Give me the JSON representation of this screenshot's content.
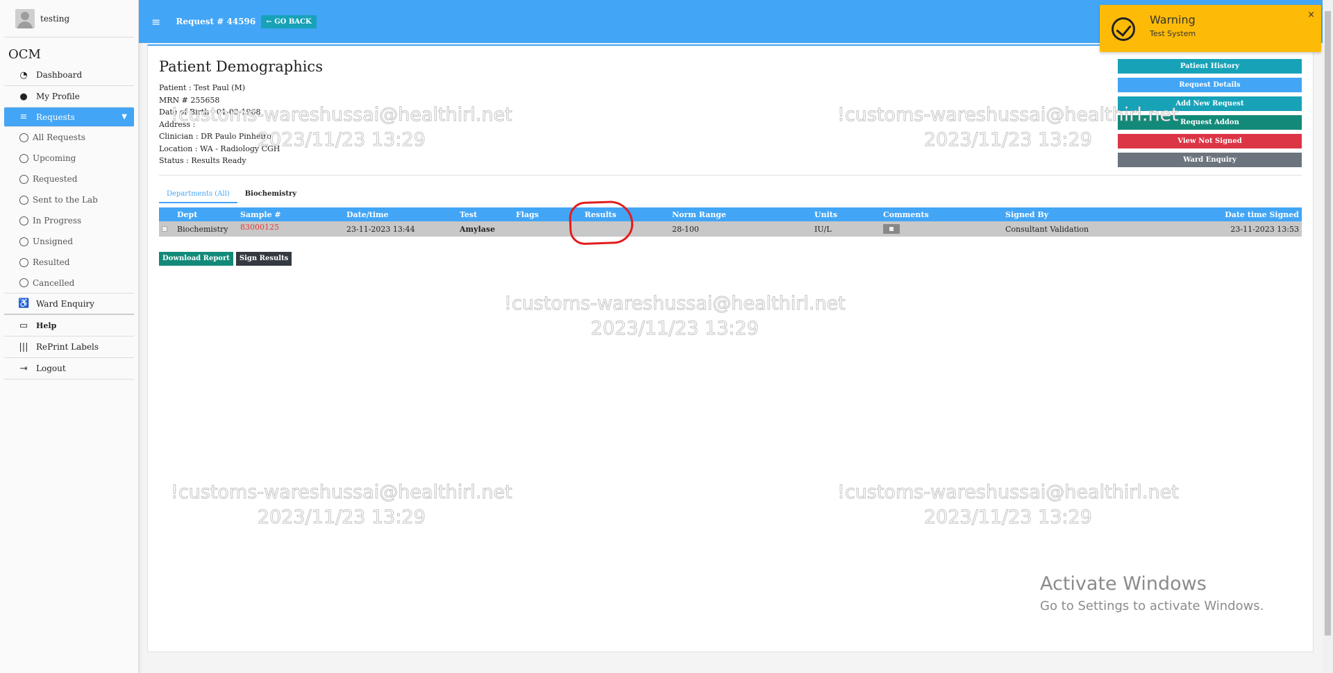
{
  "user": {
    "name": "testing"
  },
  "brand": "OCM",
  "nav": {
    "dashboard": "Dashboard",
    "profile": "My Profile",
    "requests": "Requests",
    "sub": [
      "All Requests",
      "Upcoming",
      "Requested",
      "Sent to the Lab",
      "In Progress",
      "Unsigned",
      "Resulted",
      "Cancelled"
    ],
    "ward": "Ward Enquiry",
    "help": "Help",
    "reprint": "RePrint Labels",
    "logout": "Logout"
  },
  "topbar": {
    "title": "Request # 44596",
    "go_back": "GO BACK"
  },
  "demographics": {
    "title": "Patient Demographics",
    "patient": "Patient : Test Paul (M)",
    "mrn": "MRN # 255658",
    "dob": "Date of Birth : 01-03-1968",
    "address": "Address :",
    "clinician": "Clinician : DR Paulo Pinheiro",
    "location": "Location : WA - Radiology CGH",
    "status": "Status : Results Ready"
  },
  "side_buttons": [
    {
      "label": "Patient History",
      "color": "#17a2b8"
    },
    {
      "label": "Request Details",
      "color": "#42a5f5"
    },
    {
      "label": "Add New Request",
      "color": "#17a2b8"
    },
    {
      "label": "Request Addon",
      "color": "#138a79"
    },
    {
      "label": "View Not Signed",
      "color": "#dc3545"
    },
    {
      "label": "Ward Enquiry",
      "color": "#6c757d"
    }
  ],
  "tabs": {
    "all": "Departments (All)",
    "bio": "Biochemistry"
  },
  "table": {
    "headers": [
      "Dept",
      "Sample #",
      "Date/time",
      "Test",
      "Flags",
      "Results",
      "Norm Range",
      "Units",
      "Comments",
      "Signed By",
      "Date time Signed"
    ],
    "row": {
      "dept": "Biochemistry",
      "sample": "83000125",
      "datetime": "23-11-2023 13:44",
      "test": "Amylase",
      "flags": "",
      "results": "",
      "range": "28-100",
      "units": "IU/L",
      "signed_by": "Consultant Validation",
      "signed_dt": "23-11-2023 13:53"
    }
  },
  "actions": {
    "download": "Download Report",
    "sign": "Sign Results"
  },
  "watermark": {
    "line1": "!customs-wareshussai@healthirl.net",
    "line2": "2023/11/23 13:29"
  },
  "activate": {
    "line1": "Activate Windows",
    "line2": "Go to Settings to activate Windows."
  },
  "toast": {
    "title": "Warning",
    "message": "Test System",
    "close": "×"
  }
}
